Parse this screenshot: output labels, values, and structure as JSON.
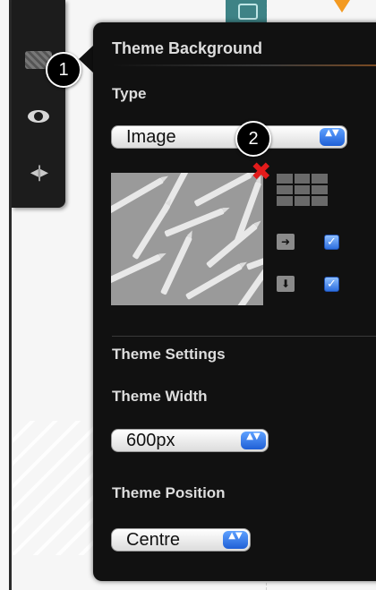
{
  "panel": {
    "title": "Theme Background",
    "type_label": "Type",
    "type_value": "Image",
    "settings_label": "Theme Settings",
    "width_label": "Theme Width",
    "width_value": "600px",
    "position_label": "Theme Position",
    "position_value": "Centre"
  },
  "stepper_glyph": "▲▼",
  "callouts": [
    "1",
    "2"
  ],
  "icons": {
    "sidebar": [
      "background-swatch-icon",
      "preview-eye-icon",
      "resize-width-icon"
    ],
    "remove": "remove-image-icon",
    "tile": "tile-grid-icon",
    "repeat_x": "repeat-horizontal-icon",
    "repeat_y": "repeat-vertical-icon"
  },
  "checkboxes": {
    "repeat_x": true,
    "repeat_y": true
  },
  "colors": {
    "panel_bg": "#111111",
    "accent_blue": "#2d6fe0",
    "remove_red": "#e21b1b",
    "teal": "#1d6f72",
    "orange": "#f39a21"
  }
}
